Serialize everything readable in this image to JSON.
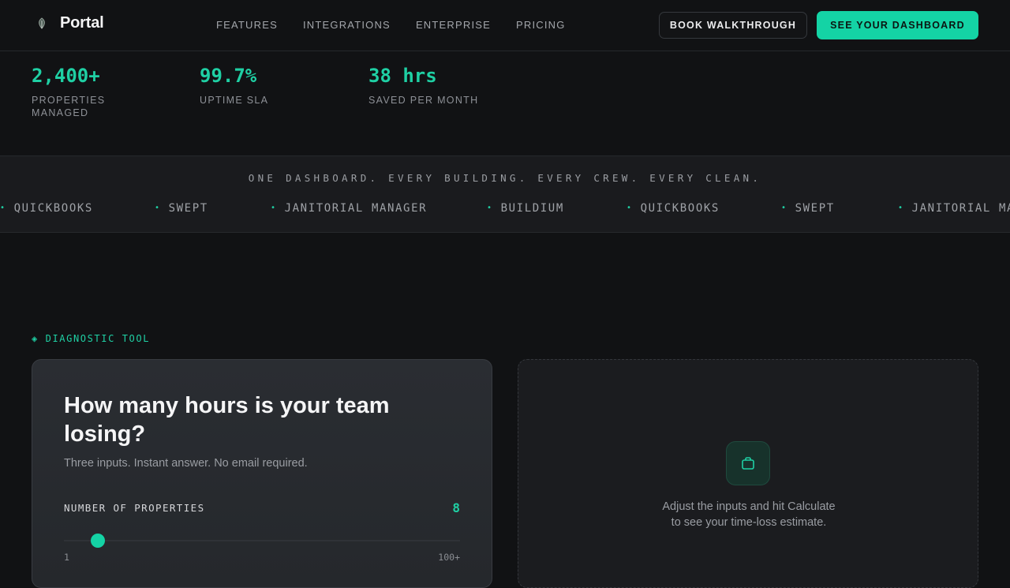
{
  "nav": {
    "brand": "Portal",
    "links": [
      "FEATURES",
      "INTEGRATIONS",
      "ENTERPRISE",
      "PRICING"
    ],
    "secondary_cta": "BOOK WALKTHROUGH",
    "primary_cta": "SEE YOUR DASHBOARD"
  },
  "stats": [
    {
      "value": "2,400+",
      "label_line1": "PROPERTIES",
      "label_line2": "MANAGED"
    },
    {
      "value": "99.7%",
      "label_line1": "UPTIME SLA",
      "label_line2": ""
    },
    {
      "value": "38 hrs",
      "label_line1": "SAVED PER MONTH",
      "label_line2": ""
    }
  ],
  "band": {
    "title": "ONE DASHBOARD. EVERY BUILDING. EVERY CREW. EVERY CLEAN.",
    "marquee": [
      "QUICKBOOKS",
      "SWEPT",
      "JANITORIAL MANAGER",
      "BUILDIUM",
      "QUICKBOOKS",
      "SWEPT",
      "JANITORIAL MANAGER"
    ]
  },
  "diagnostic": {
    "eyebrow": "◈ DIAGNOSTIC TOOL",
    "title": "How many hours is your team losing?",
    "subtitle": "Three inputs. Instant answer. No email required.",
    "field_label": "NUMBER OF PROPERTIES",
    "field_value": "8",
    "slider_fraction": 0.085,
    "range_min": "1",
    "range_max": "100+",
    "empty_line1": "Adjust the inputs and hit Calculate",
    "empty_line2": "to see your time-loss estimate."
  },
  "colors": {
    "accent": "#14d3a5",
    "background": "#111214"
  },
  "icons": {
    "brand": "leaf-icon",
    "empty_state": "briefcase-icon"
  }
}
